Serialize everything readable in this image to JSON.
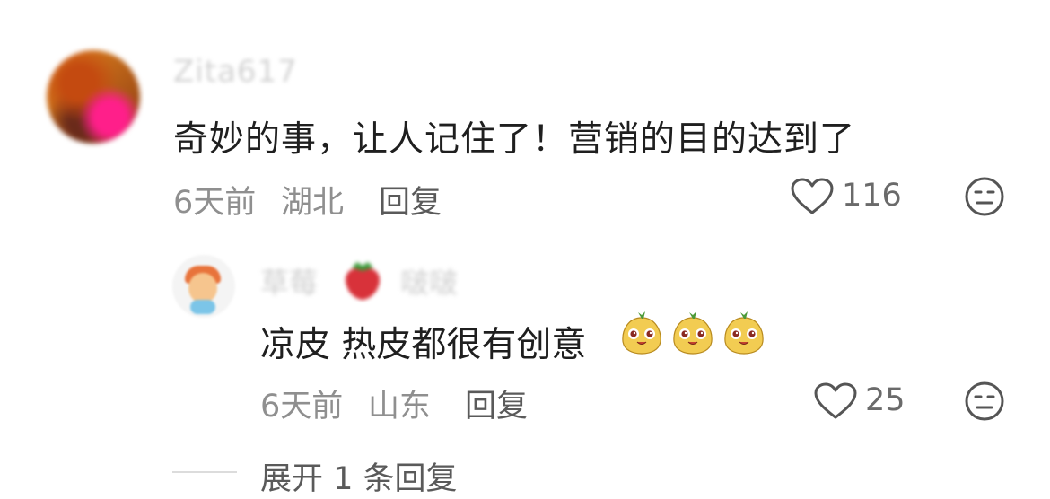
{
  "comments": [
    {
      "username": "Zita617",
      "text": "奇妙的事，让人记住了！营销的目的达到了",
      "time": "6天前",
      "location": "湖北",
      "reply_label": "回复",
      "likes": "116",
      "replies": [
        {
          "username_part1": "草莓",
          "username_part2": "啵啵",
          "text": "凉皮 热皮都很有创意",
          "emoji_count": 3,
          "time": "6天前",
          "location": "山东",
          "reply_label": "回复",
          "likes": "25"
        }
      ],
      "expand_label": "展开 1 条回复"
    }
  ],
  "icons": {
    "like": "heart-outline-icon",
    "dislike": "neutral-face-icon",
    "emoji": "cute-blob-emoji"
  },
  "colors": {
    "text": "#1f1f1f",
    "meta": "#8f8f8f",
    "secondary": "#5a5a5a",
    "blurred_name": "#d2d2d2"
  }
}
